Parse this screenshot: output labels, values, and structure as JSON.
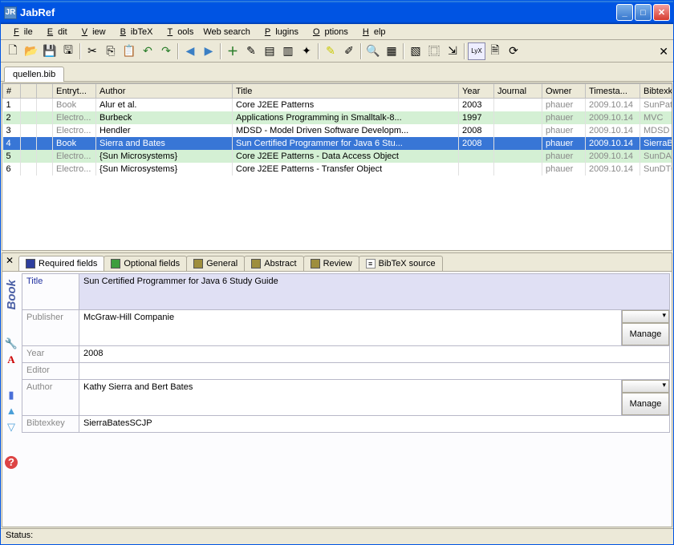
{
  "window": {
    "title": "JabRef"
  },
  "menu": {
    "file": "File",
    "edit": "Edit",
    "view": "View",
    "bibtex": "BibTeX",
    "tools": "Tools",
    "websearch": "Web search",
    "plugins": "Plugins",
    "options": "Options",
    "help": "Help"
  },
  "filetab": "quellen.bib",
  "columns": {
    "num": "#",
    "entrytype": "Entryt...",
    "author": "Author",
    "title": "Title",
    "year": "Year",
    "journal": "Journal",
    "owner": "Owner",
    "timestamp": "Timesta...",
    "bibtexkey": "Bibtexkey"
  },
  "rows": [
    {
      "n": "1",
      "type": "Book",
      "author": "Alur et al.",
      "title": "Core J2EE Patterns",
      "year": "2003",
      "journal": "",
      "owner": "phauer",
      "ts": "2009.10.14",
      "key": "SunPatte...",
      "alt": 0,
      "sel": false
    },
    {
      "n": "2",
      "type": "Electro...",
      "author": "Burbeck",
      "title": "Applications Programming in Smalltalk-8...",
      "year": "1997",
      "journal": "",
      "owner": "phauer",
      "ts": "2009.10.14",
      "key": "MVC",
      "alt": 1,
      "sel": false
    },
    {
      "n": "3",
      "type": "Electro...",
      "author": "Hendler",
      "title": "MDSD - Model Driven Software Developm...",
      "year": "2008",
      "journal": "",
      "owner": "phauer",
      "ts": "2009.10.14",
      "key": "MDSD",
      "alt": 0,
      "sel": false
    },
    {
      "n": "4",
      "type": "Book",
      "author": "Sierra and Bates",
      "title": "Sun Certified Programmer for Java 6 Stu...",
      "year": "2008",
      "journal": "",
      "owner": "phauer",
      "ts": "2009.10.14",
      "key": "SierraBat...",
      "alt": 0,
      "sel": true
    },
    {
      "n": "5",
      "type": "Electro...",
      "author": "{Sun Microsystems}",
      "title": "Core J2EE Patterns - Data Access Object",
      "year": "",
      "journal": "",
      "owner": "phauer",
      "ts": "2009.10.14",
      "key": "SunDAO",
      "alt": 1,
      "sel": false
    },
    {
      "n": "6",
      "type": "Electro...",
      "author": "{Sun Microsystems}",
      "title": "Core J2EE Patterns - Transfer Object",
      "year": "",
      "journal": "",
      "owner": "phauer",
      "ts": "2009.10.14",
      "key": "SunDTO",
      "alt": 0,
      "sel": false
    }
  ],
  "editor": {
    "type_label": "Book",
    "tabs": {
      "required": "Required fields",
      "optional": "Optional fields",
      "general": "General",
      "abstract": "Abstract",
      "review": "Review",
      "source": "BibTeX source"
    },
    "labels": {
      "title": "Title",
      "publisher": "Publisher",
      "year": "Year",
      "editor": "Editor",
      "author": "Author",
      "bibtexkey": "Bibtexkey",
      "manage": "Manage"
    },
    "values": {
      "title": "Sun Certified Programmer for Java 6 Study Guide",
      "publisher": "McGraw-Hill Companie",
      "year": "2008",
      "editor": "",
      "author": "Kathy Sierra and Bert Bates",
      "bibtexkey": "SierraBatesSCJP"
    }
  },
  "status": {
    "label": "Status:"
  },
  "icons": {
    "new": "🗋",
    "open": "📂",
    "save": "💾",
    "saveall": "🖫",
    "cut": "✂",
    "copy": "⎘",
    "paste": "📋",
    "undo": "↶",
    "redo": "↷",
    "back": "◀",
    "fwd": "▶",
    "add": "＋",
    "edit": "✎",
    "form": "▤",
    "form2": "▥",
    "wand": "✦",
    "mark": "✎",
    "mark2": "✐",
    "search": "🔍",
    "props": "▦",
    "cols": "▧",
    "dup": "⿴",
    "exp": "⇲",
    "lyx": "LyX",
    "note": "🗎",
    "refresh": "⟳",
    "wrench": "🔧",
    "pdf": "A",
    "blue": "▮",
    "up": "▲",
    "down": "▽",
    "help": "?"
  }
}
